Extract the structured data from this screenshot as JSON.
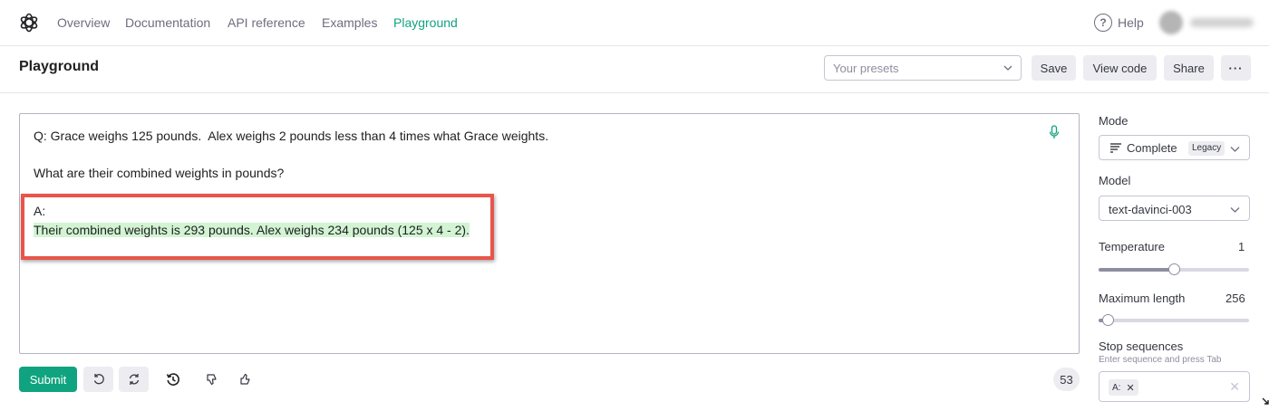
{
  "nav": {
    "links": [
      "Overview",
      "Documentation",
      "API reference",
      "Examples",
      "Playground"
    ],
    "active": "Playground",
    "help": "Help"
  },
  "header": {
    "title": "Playground",
    "presets_placeholder": "Your presets",
    "save": "Save",
    "view_code": "View code",
    "share": "Share",
    "more": "···"
  },
  "editor": {
    "lines": [
      "Q: Grace weighs 125 pounds.  Alex weighs 2 pounds less than 4 times what Grace weights.",
      "What are their combined weights in pounds?",
      "A:"
    ],
    "completion": "Their combined weights is 293 pounds. Alex weighs 234 pounds (125 x 4 - 2)."
  },
  "bottom": {
    "submit": "Submit",
    "token_count": "53"
  },
  "panel": {
    "mode_label": "Mode",
    "mode_value": "Complete",
    "mode_badge": "Legacy",
    "model_label": "Model",
    "model_value": "text-davinci-003",
    "temperature_label": "Temperature",
    "temperature_value": "1",
    "temperature_fraction": 0.5,
    "max_length_label": "Maximum length",
    "max_length_value": "256",
    "max_length_fraction": 0.06,
    "stop_label": "Stop sequences",
    "stop_hint": "Enter sequence and press Tab",
    "stop_chip": "A:"
  },
  "colors": {
    "accent": "#10a37f",
    "completion_highlight": "#d2f4d3",
    "annotation_box": "#e8554b"
  }
}
